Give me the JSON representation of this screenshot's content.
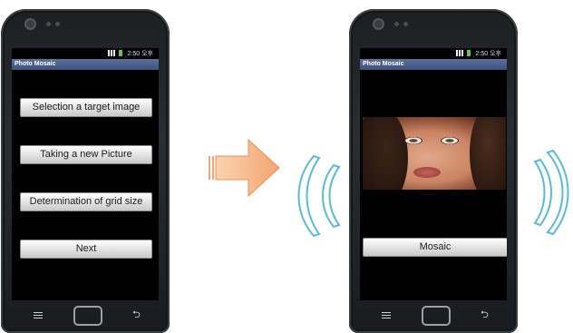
{
  "left_screen": {
    "status_time": "2:50 오후",
    "app_title": "Photo Mosaic",
    "buttons": [
      "Selection a target image",
      "Taking a new Picture",
      "Determination of grid size",
      "Next"
    ]
  },
  "right_screen": {
    "status_time": "2:50 오후",
    "app_title": "Photo Mosaic",
    "button": "Mosaic"
  },
  "colors": {
    "title_bar": "#3d527e",
    "arrow": "#f4a570",
    "waves": "#5bbbd6"
  },
  "icons": [
    "camera-icon",
    "signal-icon",
    "battery-icon",
    "menu-icon",
    "home-button",
    "back-icon",
    "arrow-icon",
    "wave-icon"
  ]
}
